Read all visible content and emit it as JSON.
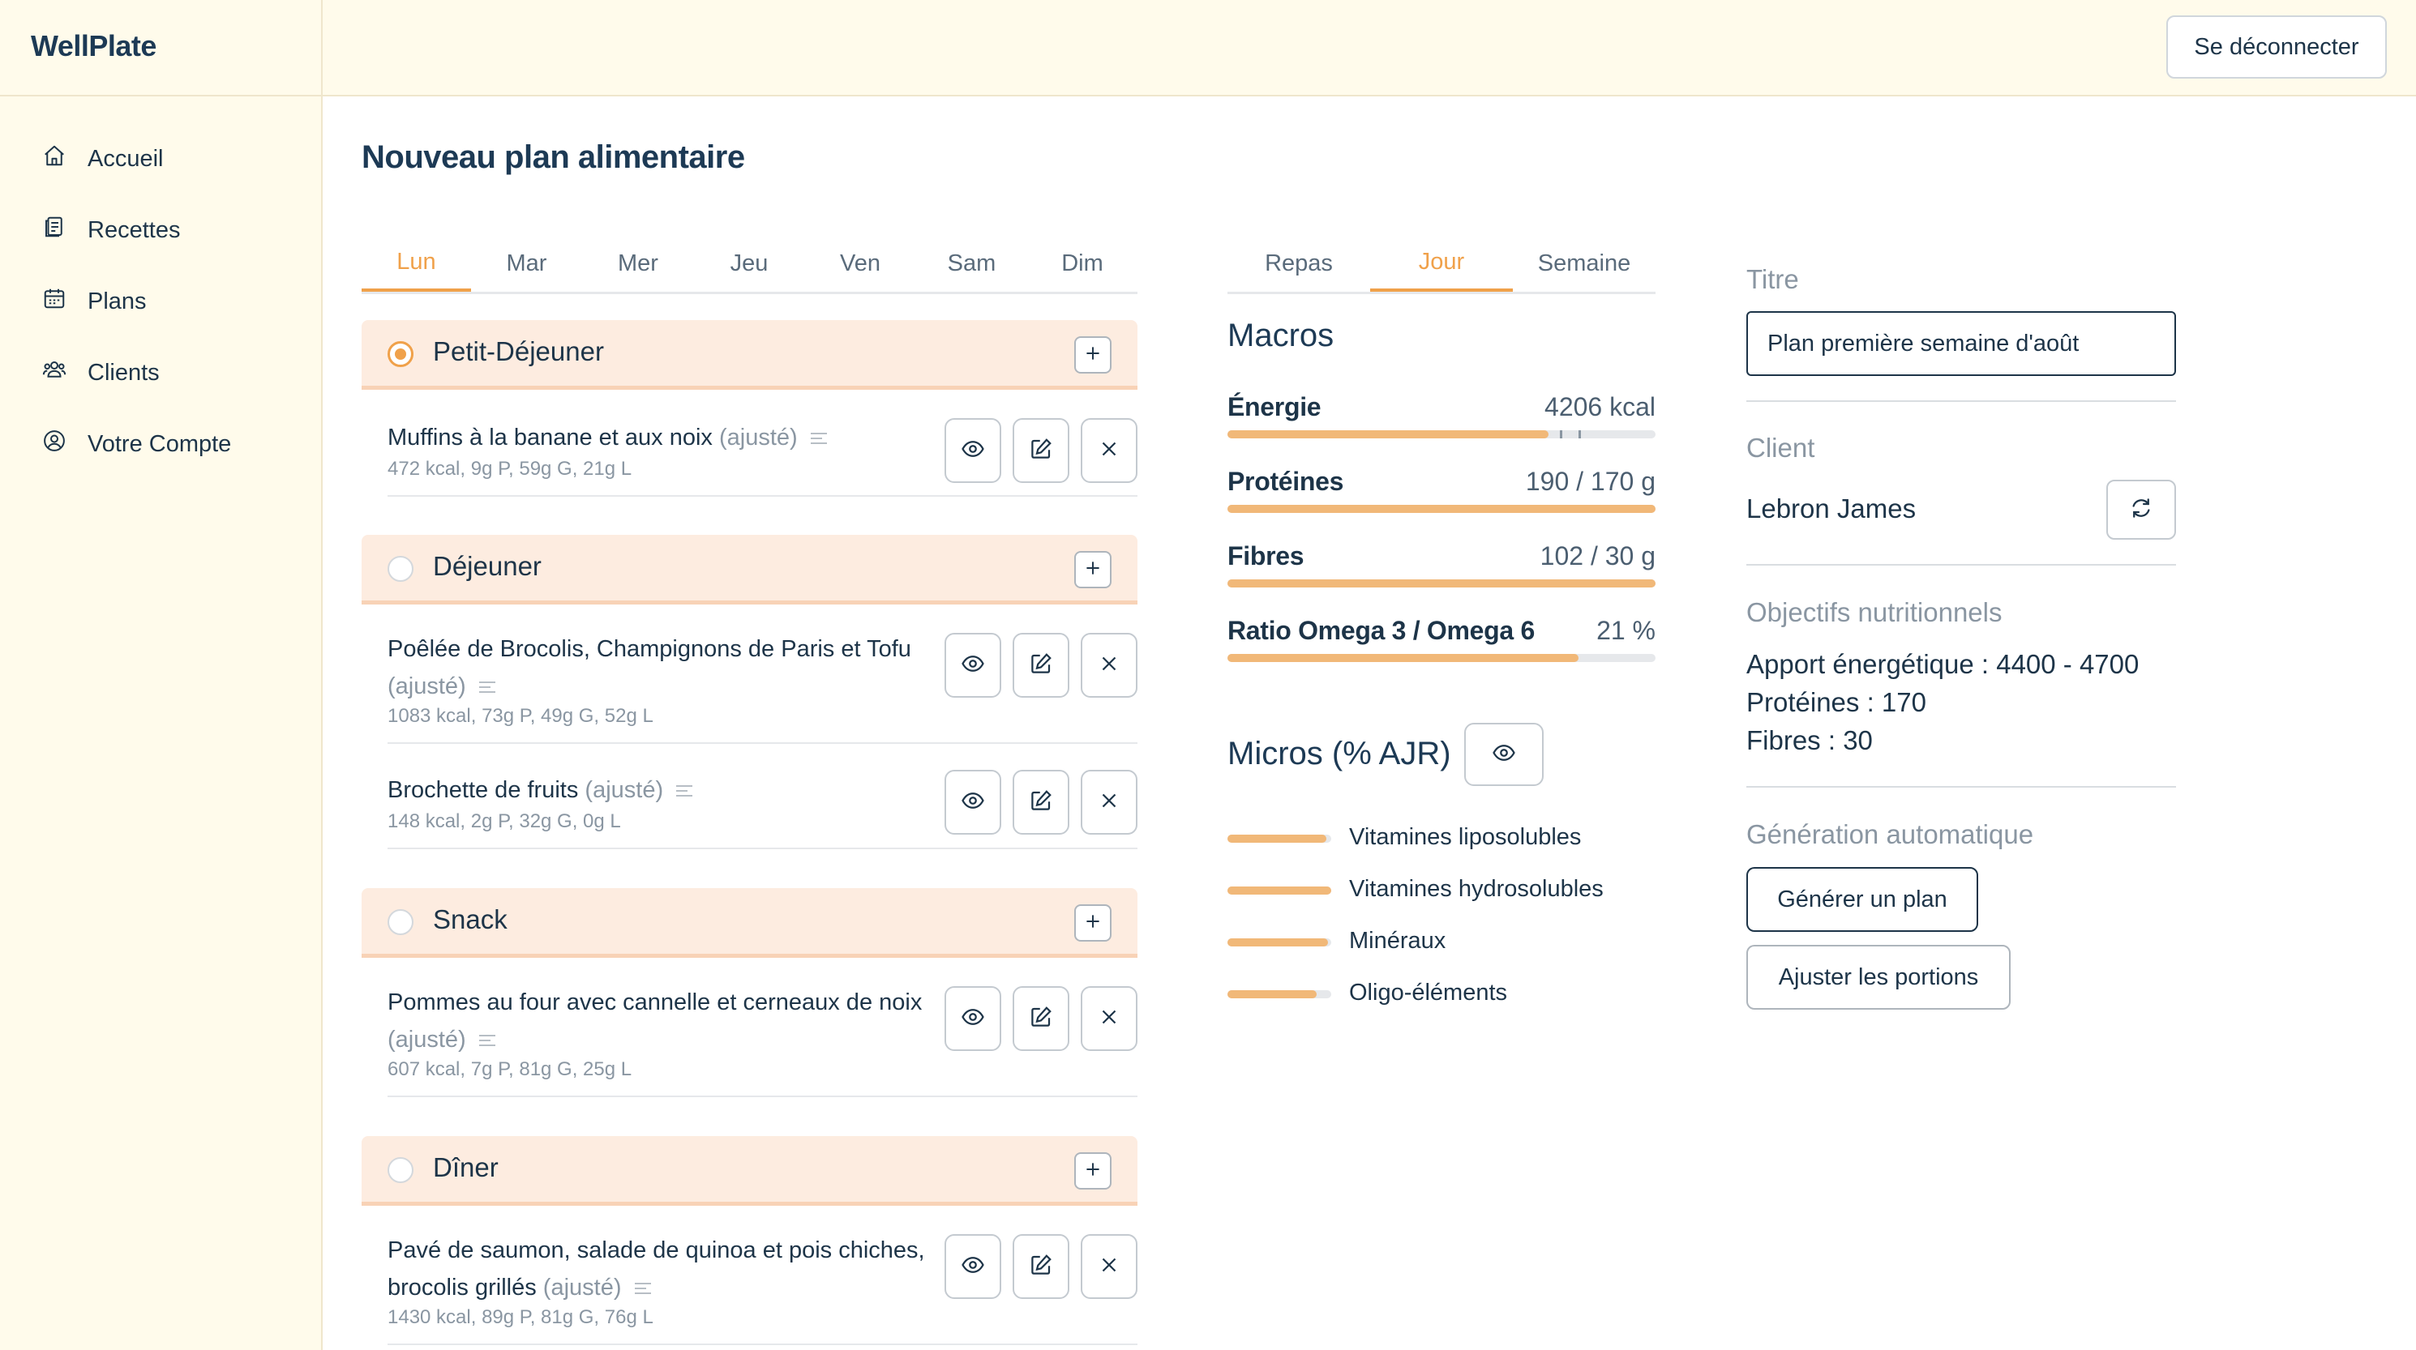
{
  "app": {
    "brand": "WellPlate",
    "logout_label": "Se déconnecter"
  },
  "sidebar": {
    "items": [
      {
        "label": "Accueil",
        "icon": "home-icon"
      },
      {
        "label": "Recettes",
        "icon": "recipes-icon"
      },
      {
        "label": "Plans",
        "icon": "calendar-icon"
      },
      {
        "label": "Clients",
        "icon": "users-icon"
      },
      {
        "label": "Votre Compte",
        "icon": "account-icon"
      }
    ]
  },
  "page": {
    "title": "Nouveau plan alimentaire"
  },
  "day_tabs": {
    "items": [
      "Lun",
      "Mar",
      "Mer",
      "Jeu",
      "Ven",
      "Sam",
      "Dim"
    ],
    "active": "Lun"
  },
  "meals": [
    {
      "title": "Petit-Déjeuner",
      "selected": true,
      "recipes": [
        {
          "name": "Muffins à la banane et aux noix",
          "adjusted": "(ajusté)",
          "macros": "472 kcal, 9g P, 59g G, 21g L"
        }
      ]
    },
    {
      "title": "Déjeuner",
      "selected": false,
      "recipes": [
        {
          "name": "Poêlée de Brocolis, Champignons de Paris et Tofu",
          "adjusted": "(ajusté)",
          "macros": "1083 kcal, 73g P, 49g G, 52g L"
        },
        {
          "name": "Brochette de fruits",
          "adjusted": "(ajusté)",
          "macros": "148 kcal, 2g P, 32g G, 0g L"
        }
      ]
    },
    {
      "title": "Snack",
      "selected": false,
      "recipes": [
        {
          "name": "Pommes au four avec cannelle et cerneaux de noix",
          "adjusted": "(ajusté)",
          "macros": "607 kcal, 7g P, 81g G, 25g L"
        }
      ]
    },
    {
      "title": "Dîner",
      "selected": false,
      "recipes": [
        {
          "name": "Pavé de saumon, salade de quinoa et pois chiches, brocolis grillés",
          "adjusted": "(ajusté)",
          "macros": "1430 kcal, 89g P, 81g G, 76g L"
        }
      ]
    }
  ],
  "view_tabs": {
    "items": [
      "Repas",
      "Jour",
      "Semaine"
    ],
    "active": "Jour"
  },
  "macros": {
    "title": "Macros",
    "items": [
      {
        "label": "Énergie",
        "value": "4206 kcal",
        "fill": 0.75
      },
      {
        "label": "Protéines",
        "value": "190 / 170 g",
        "fill": 1.0
      },
      {
        "label": "Fibres",
        "value": "102 / 30 g",
        "fill": 1.0
      },
      {
        "label": "Ratio Omega 3 / Omega 6",
        "value": "21 %",
        "fill": 0.82
      }
    ]
  },
  "micros": {
    "title": "Micros (% AJR)",
    "items": [
      {
        "label": "Vitamines liposolubles",
        "fill": 0.95
      },
      {
        "label": "Vitamines hydrosolubles",
        "fill": 1.0
      },
      {
        "label": "Minéraux",
        "fill": 0.97
      },
      {
        "label": "Oligo-éléments",
        "fill": 0.86
      }
    ]
  },
  "right_panel": {
    "title_label": "Titre",
    "title_value": "Plan première semaine d'août",
    "client_label": "Client",
    "client_name": "Lebron James",
    "goals_label": "Objectifs nutritionnels",
    "goals": [
      "Apport énergétique : 4400 - 4700",
      "Protéines : 170",
      "Fibres : 30"
    ],
    "auto_label": "Génération automatique",
    "generate_label": "Générer un plan",
    "adjust_label": "Ajuster les portions"
  },
  "colors": {
    "accent": "#f0a14a",
    "bar": "#f1b878",
    "cream": "#fffbeb",
    "meal_header": "#fdece0",
    "text": "#1d3448"
  }
}
